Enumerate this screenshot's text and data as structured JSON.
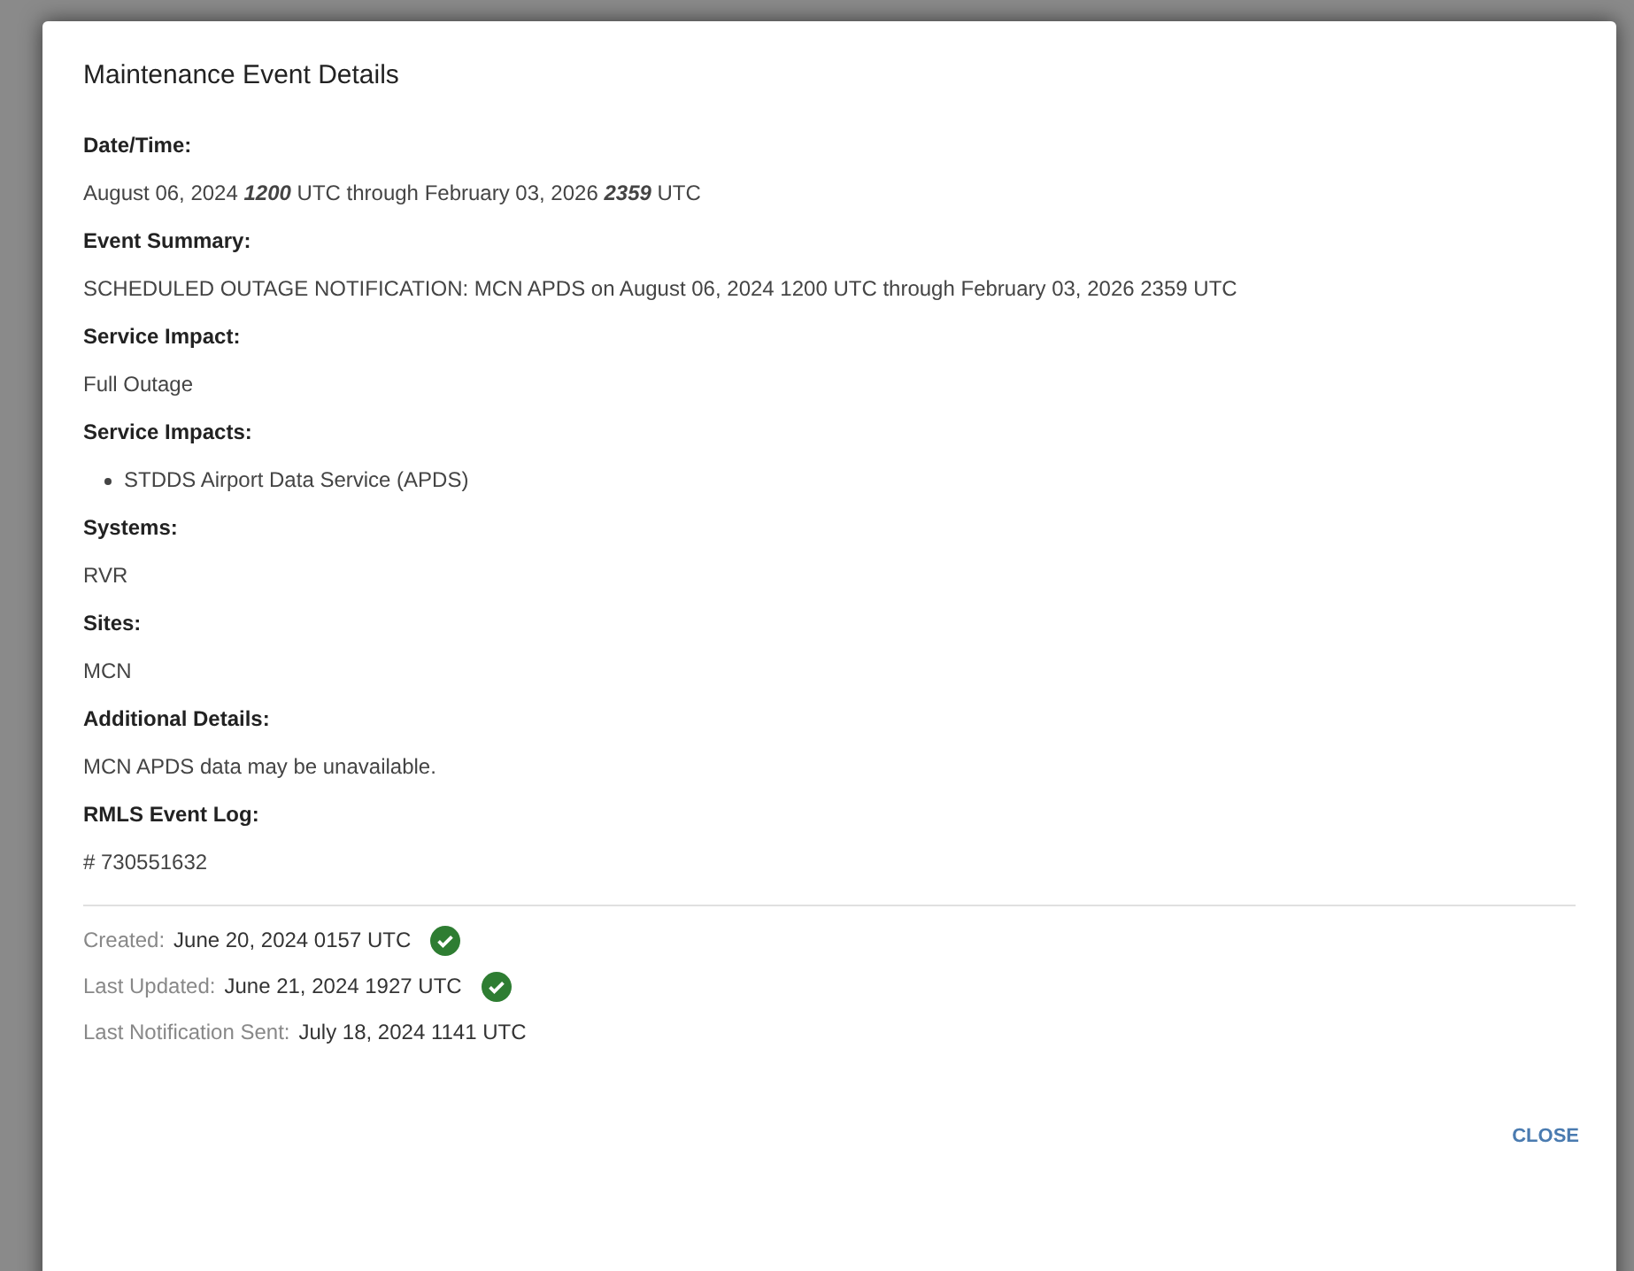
{
  "dialog": {
    "title": "Maintenance Event Details"
  },
  "fields": [
    {
      "label": "Date/Time:",
      "kind": "text",
      "value": "August 06, 2024 **1200** UTC through February 03, 2026 **2359** UTC"
    },
    {
      "label": "Event Summary:",
      "kind": "text",
      "value": "SCHEDULED OUTAGE NOTIFICATION: MCN APDS on August 06, 2024 1200 UTC through February 03, 2026 2359 UTC"
    },
    {
      "label": "Service Impact:",
      "kind": "text",
      "value": "Full Outage"
    },
    {
      "label": "Service Impacts:",
      "kind": "list",
      "items": [
        "STDDS Airport Data Service (APDS)"
      ]
    },
    {
      "label": "Systems:",
      "kind": "text",
      "value": "RVR"
    },
    {
      "label": "Sites:",
      "kind": "text",
      "value": "MCN"
    },
    {
      "label": "Additional Details:",
      "kind": "text",
      "value": "MCN APDS data may be unavailable."
    },
    {
      "label": "RMLS Event Log:",
      "kind": "text",
      "value": "# 730551632"
    }
  ],
  "footer": [
    {
      "label": "Created:",
      "value": "June 20, 2024 0157 UTC",
      "verified": true
    },
    {
      "label": "Last Updated:",
      "value": "June 21, 2024 1927 UTC",
      "verified": true
    },
    {
      "label": "Last Notification Sent:",
      "value": "July 18, 2024 1141 UTC",
      "verified": false
    }
  ],
  "actions": [
    "CLOSE"
  ]
}
